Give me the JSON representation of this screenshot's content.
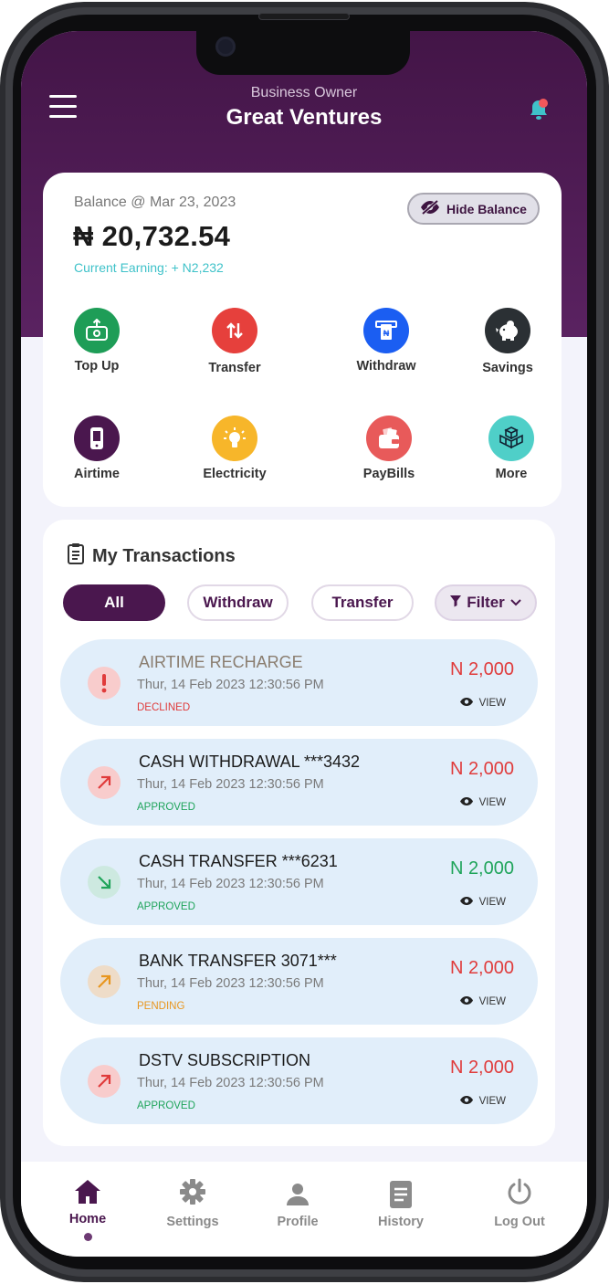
{
  "header": {
    "subtitle": "Business Owner",
    "title": "Great Ventures"
  },
  "balance": {
    "label": "Balance @ Mar 23, 2023",
    "amount": "₦ 20,732.54",
    "earning": "Current Earning: + N2,232",
    "hide_label": "Hide Balance"
  },
  "actions": [
    {
      "label": "Top Up",
      "icon": "top-up-icon",
      "color": "#1e9d57"
    },
    {
      "label": "Transfer",
      "icon": "transfer-icon",
      "color": "#e6403c"
    },
    {
      "label": "Withdraw",
      "icon": "withdraw-icon",
      "color": "#1b5ef2"
    },
    {
      "label": "Savings",
      "icon": "piggy-bank-icon",
      "color": "#2b3034"
    },
    {
      "label": "Airtime",
      "icon": "phone-icon",
      "color": "#4a174e"
    },
    {
      "label": "Electricity",
      "icon": "bulb-icon",
      "color": "#f7b62a"
    },
    {
      "label": "PayBills",
      "icon": "wallet-icon",
      "color": "#e85a5a"
    },
    {
      "label": "More",
      "icon": "cubes-icon",
      "color": "#4fcfc8"
    }
  ],
  "transactions": {
    "title": "My Transactions",
    "filters": [
      "All",
      "Withdraw",
      "Transfer"
    ],
    "filter_label": "Filter",
    "view_label": "VIEW",
    "items": [
      {
        "name": "AIRTIME RECHARGE",
        "date": "Thur, 14 Feb 2023 12:30:56 PM",
        "status": "DECLINED",
        "amount": "N 2,000",
        "status_color": "#e03b3b",
        "amount_color": "#e03b3b",
        "icon": "exclamation-icon"
      },
      {
        "name": "CASH WITHDRAWAL ***3432",
        "date": "Thur, 14 Feb 2023 12:30:56 PM",
        "status": "APPROVED",
        "amount": "N 2,000",
        "status_color": "#1fa45a",
        "amount_color": "#e03b3b",
        "icon": "arrow-up-right-icon"
      },
      {
        "name": "CASH TRANSFER ***6231",
        "date": "Thur, 14 Feb 2023 12:30:56 PM",
        "status": "APPROVED",
        "amount": "N 2,000",
        "status_color": "#1fa45a",
        "amount_color": "#1fa45a",
        "icon": "arrow-down-right-icon"
      },
      {
        "name": "BANK TRANSFER 3071***",
        "date": "Thur, 14 Feb 2023 12:30:56 PM",
        "status": "PENDING",
        "amount": "N 2,000",
        "status_color": "#e8961f",
        "amount_color": "#e03b3b",
        "icon": "arrow-up-right-icon"
      },
      {
        "name": "DSTV SUBSCRIPTION",
        "date": "Thur, 14 Feb 2023 12:30:56 PM",
        "status": "APPROVED",
        "amount": "N 2,000",
        "status_color": "#1fa45a",
        "amount_color": "#e03b3b",
        "icon": "arrow-up-right-icon"
      }
    ]
  },
  "nav": [
    {
      "label": "Home",
      "icon": "home-icon",
      "active": true
    },
    {
      "label": "Settings",
      "icon": "gear-icon"
    },
    {
      "label": "Profile",
      "icon": "person-icon"
    },
    {
      "label": "History",
      "icon": "document-icon"
    },
    {
      "label": "Log Out",
      "icon": "power-icon"
    }
  ],
  "colors": {
    "brand": "#4a174e",
    "header_gradient": [
      "#431547",
      "#5a2261"
    ],
    "row_bg": "#e1eefa",
    "accent_teal": "#3fc2c9"
  }
}
